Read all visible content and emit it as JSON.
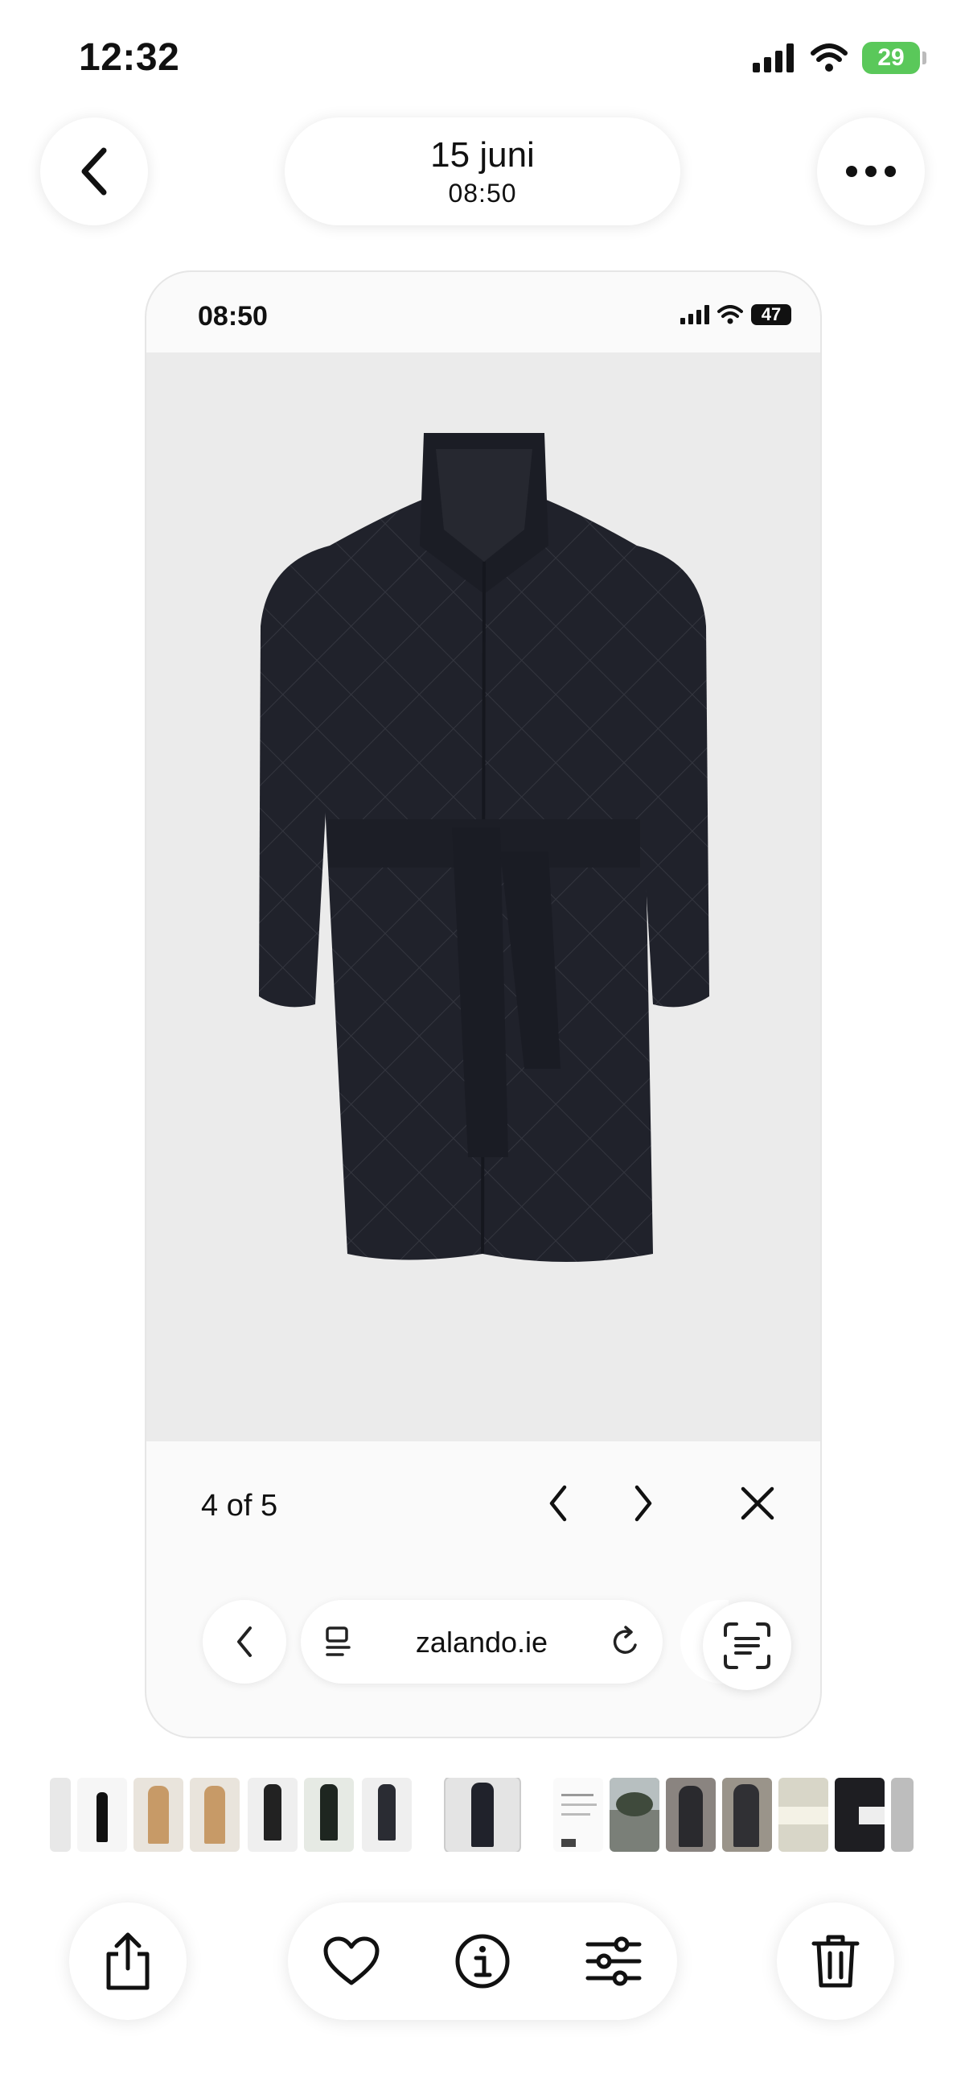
{
  "status_bar": {
    "time": "12:32",
    "battery": "29"
  },
  "header": {
    "date": "15 juni",
    "time": "08:50"
  },
  "screenshot": {
    "status_time": "08:50",
    "battery": "47",
    "viewer": {
      "counter": "4 of 5"
    },
    "browser": {
      "url": "zalando.ie"
    }
  },
  "icons": {
    "back": "chevron-left-icon",
    "more": "more-icon",
    "share": "share-icon",
    "favorite": "heart-icon",
    "info": "info-icon",
    "adjust": "sliders-icon",
    "delete": "trash-icon"
  },
  "colors": {
    "battery_green": "#5ac85a",
    "coat": "#20222b"
  }
}
